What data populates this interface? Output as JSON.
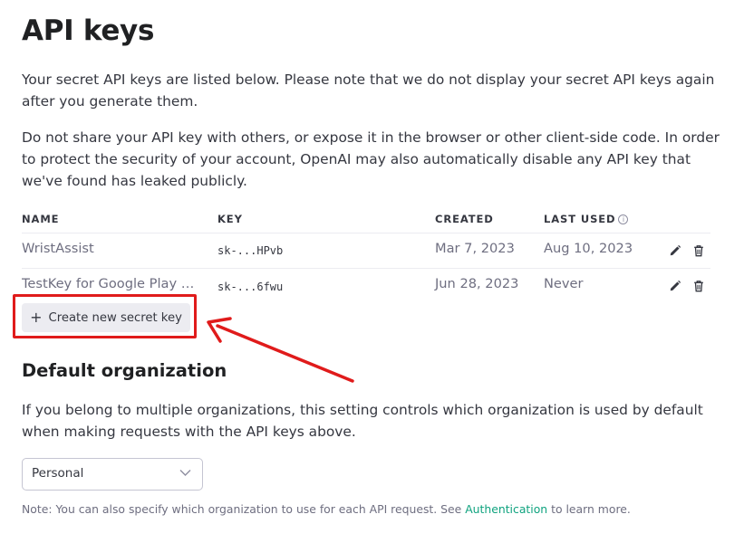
{
  "page": {
    "title": "API keys",
    "intro_1": "Your secret API keys are listed below. Please note that we do not display your secret API keys again after you generate them.",
    "intro_2": "Do not share your API key with others, or expose it in the browser or other client-side code. In order to protect the security of your account, OpenAI may also automatically disable any API key that we've found has leaked publicly."
  },
  "table": {
    "headers": {
      "name": "NAME",
      "key": "KEY",
      "created": "CREATED",
      "last_used": "LAST USED"
    },
    "last_used_info_icon": "info-icon",
    "rows": [
      {
        "name": "WristAssist",
        "key": "sk-...HPvb",
        "created": "Mar 7, 2023",
        "last_used": "Aug 10, 2023"
      },
      {
        "name": "TestKey for Google Play Co...",
        "key": "sk-...6fwu",
        "created": "Jun 28, 2023",
        "last_used": "Never"
      }
    ],
    "row_action_icons": [
      "pencil-icon",
      "trash-icon"
    ]
  },
  "create_button": {
    "icon": "plus-icon",
    "label": "Create new secret key"
  },
  "annotation": {
    "color": "#e01b1b"
  },
  "default_org": {
    "title": "Default organization",
    "description": "If you belong to multiple organizations, this setting controls which organization is used by default when making requests with the API keys above.",
    "select_value": "Personal",
    "note_before": "Note: You can also specify which organization to use for each API request. See ",
    "note_link": "Authentication",
    "note_after": " to learn more."
  },
  "colors": {
    "accent": "#10a37f",
    "text": "#353740",
    "muted": "#6e6e80",
    "button_bg": "#ececf1"
  }
}
